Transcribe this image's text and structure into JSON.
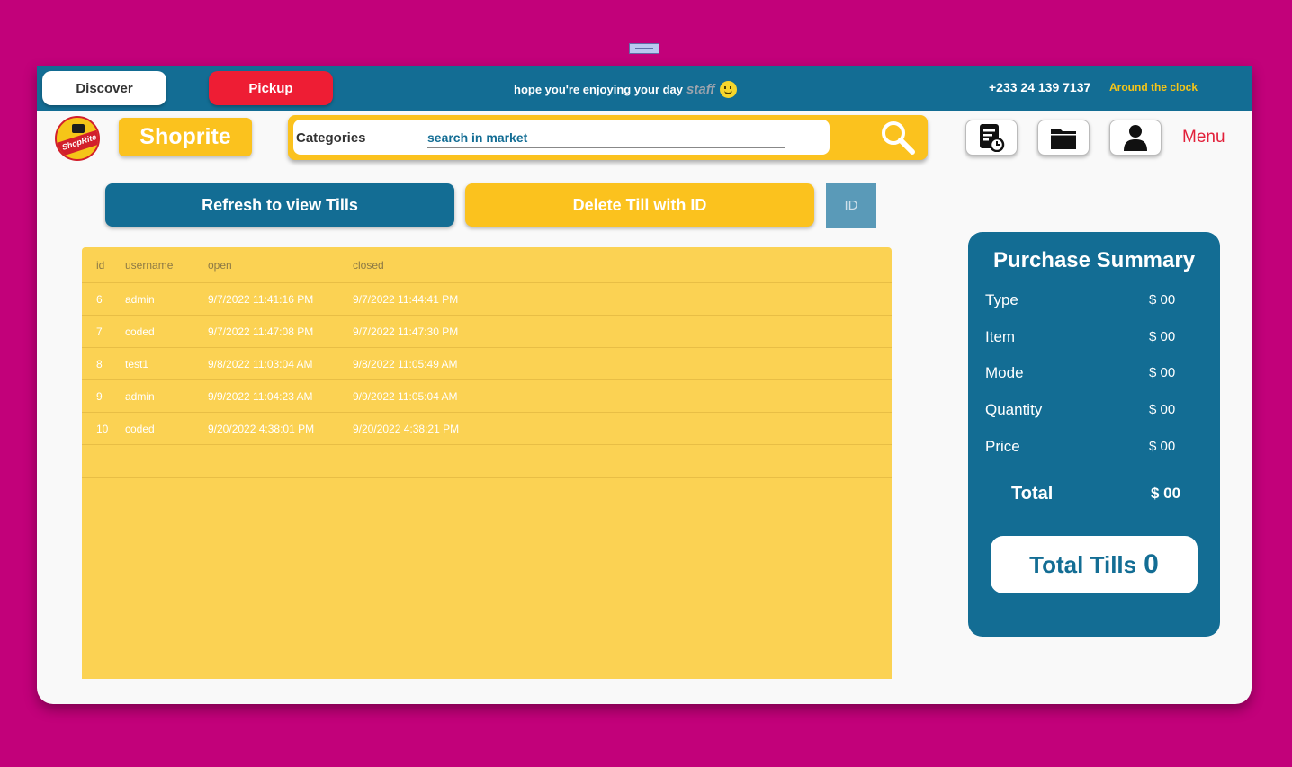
{
  "topbar": {
    "discover_label": "Discover",
    "pickup_label": "Pickup",
    "greeting": "hope you're enjoying your day",
    "greeting_role": "staff",
    "phone": "+233 24 139 7137",
    "availability": "Around the clock"
  },
  "header": {
    "logo_text": "ShopRite",
    "brand": "Shoprite",
    "categories_label": "Categories",
    "search_placeholder": "search in market",
    "menu_label": "Menu",
    "icons": [
      "report-history-icon",
      "folder-icon",
      "user-icon",
      "search-icon"
    ]
  },
  "actions": {
    "refresh_label": "Refresh to view Tills",
    "delete_label": "Delete Till with ID",
    "id_placeholder": "ID"
  },
  "tills_table": {
    "columns": [
      "id",
      "username",
      "open",
      "closed"
    ],
    "rows": [
      {
        "id": "6",
        "username": "admin",
        "open": "9/7/2022 11:41:16 PM",
        "closed": "9/7/2022 11:44:41 PM"
      },
      {
        "id": "7",
        "username": "coded",
        "open": "9/7/2022 11:47:08 PM",
        "closed": "9/7/2022 11:47:30 PM"
      },
      {
        "id": "8",
        "username": "test1",
        "open": "9/8/2022 11:03:04 AM",
        "closed": "9/8/2022 11:05:49 AM"
      },
      {
        "id": "9",
        "username": "admin",
        "open": "9/9/2022 11:04:23 AM",
        "closed": "9/9/2022 11:05:04 AM"
      },
      {
        "id": "10",
        "username": "coded",
        "open": "9/20/2022 4:38:01 PM",
        "closed": "9/20/2022 4:38:21 PM"
      }
    ]
  },
  "summary": {
    "title": "Purchase Summary",
    "items": [
      {
        "label": "Type",
        "value": "$ 00"
      },
      {
        "label": "Item",
        "value": "$ 00"
      },
      {
        "label": "Mode",
        "value": "$ 00"
      },
      {
        "label": "Quantity",
        "value": "$ 00"
      },
      {
        "label": "Price",
        "value": "$ 00"
      }
    ],
    "total_label": "Total",
    "total_value": "$ 00",
    "tills_label": "Total Tills",
    "tills_count": "0"
  },
  "colors": {
    "page_background": "#c2017a",
    "primary_blue": "#136d94",
    "accent_yellow": "#fbc21e",
    "pickup_red": "#ee1d34",
    "table_yellow": "#fbd253",
    "menu_red": "#e2203a"
  }
}
